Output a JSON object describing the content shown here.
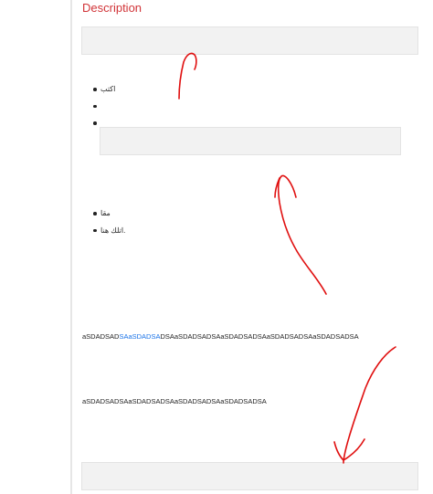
{
  "section": {
    "title": "Description"
  },
  "bullets_top": [
    "اكتب",
    "",
    ""
  ],
  "bullets_bottom": [
    "مقا",
    "اتلك هنا."
  ],
  "text_lines": {
    "line1_before": "aSDADSAD",
    "line1_link": "SAaSDADSA",
    "line1_after": "DSAaSDADSADSAaSDADSADSAaSDADSADSAaSDADSADSA",
    "line2": "aSDADSADSAaSDADSADSAaSDADSADSAaSDADSADSA"
  },
  "colors": {
    "title": "#d13438",
    "link": "#1a73e8",
    "annotation": "#e01010",
    "field_background": "#f2f2f2"
  }
}
